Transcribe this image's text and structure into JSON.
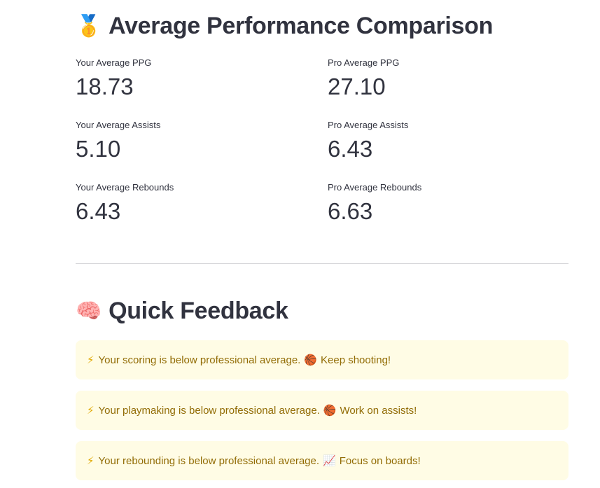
{
  "performance": {
    "icon": "medal",
    "emoji": "🥇",
    "title": "Average Performance Comparison",
    "metrics": [
      {
        "label": "Your Average PPG",
        "value": "18.73"
      },
      {
        "label": "Pro Average PPG",
        "value": "27.10"
      },
      {
        "label": "Your Average Assists",
        "value": "5.10"
      },
      {
        "label": "Pro Average Assists",
        "value": "6.43"
      },
      {
        "label": "Your Average Rebounds",
        "value": "6.43"
      },
      {
        "label": "Pro Average Rebounds",
        "value": "6.63"
      }
    ]
  },
  "feedback": {
    "icon": "brain",
    "emoji": "🧠",
    "title": "Quick Feedback",
    "alerts": [
      {
        "icon": "lightning",
        "lead": "⚡",
        "text": "Your scoring is below professional average.",
        "icon2": "basketball",
        "mid": "🏀",
        "tail": "Keep shooting!"
      },
      {
        "icon": "lightning",
        "lead": "⚡",
        "text": "Your playmaking is below professional average.",
        "icon2": "basketball",
        "mid": "🏀",
        "tail": "Work on assists!"
      },
      {
        "icon": "lightning",
        "lead": "⚡",
        "text": "Your rebounding is below professional average.",
        "icon2": "chart-increasing",
        "mid": "📈",
        "tail": "Focus on boards!"
      }
    ],
    "alert_background": "#fffce5",
    "alert_text_color": "#926c05"
  }
}
